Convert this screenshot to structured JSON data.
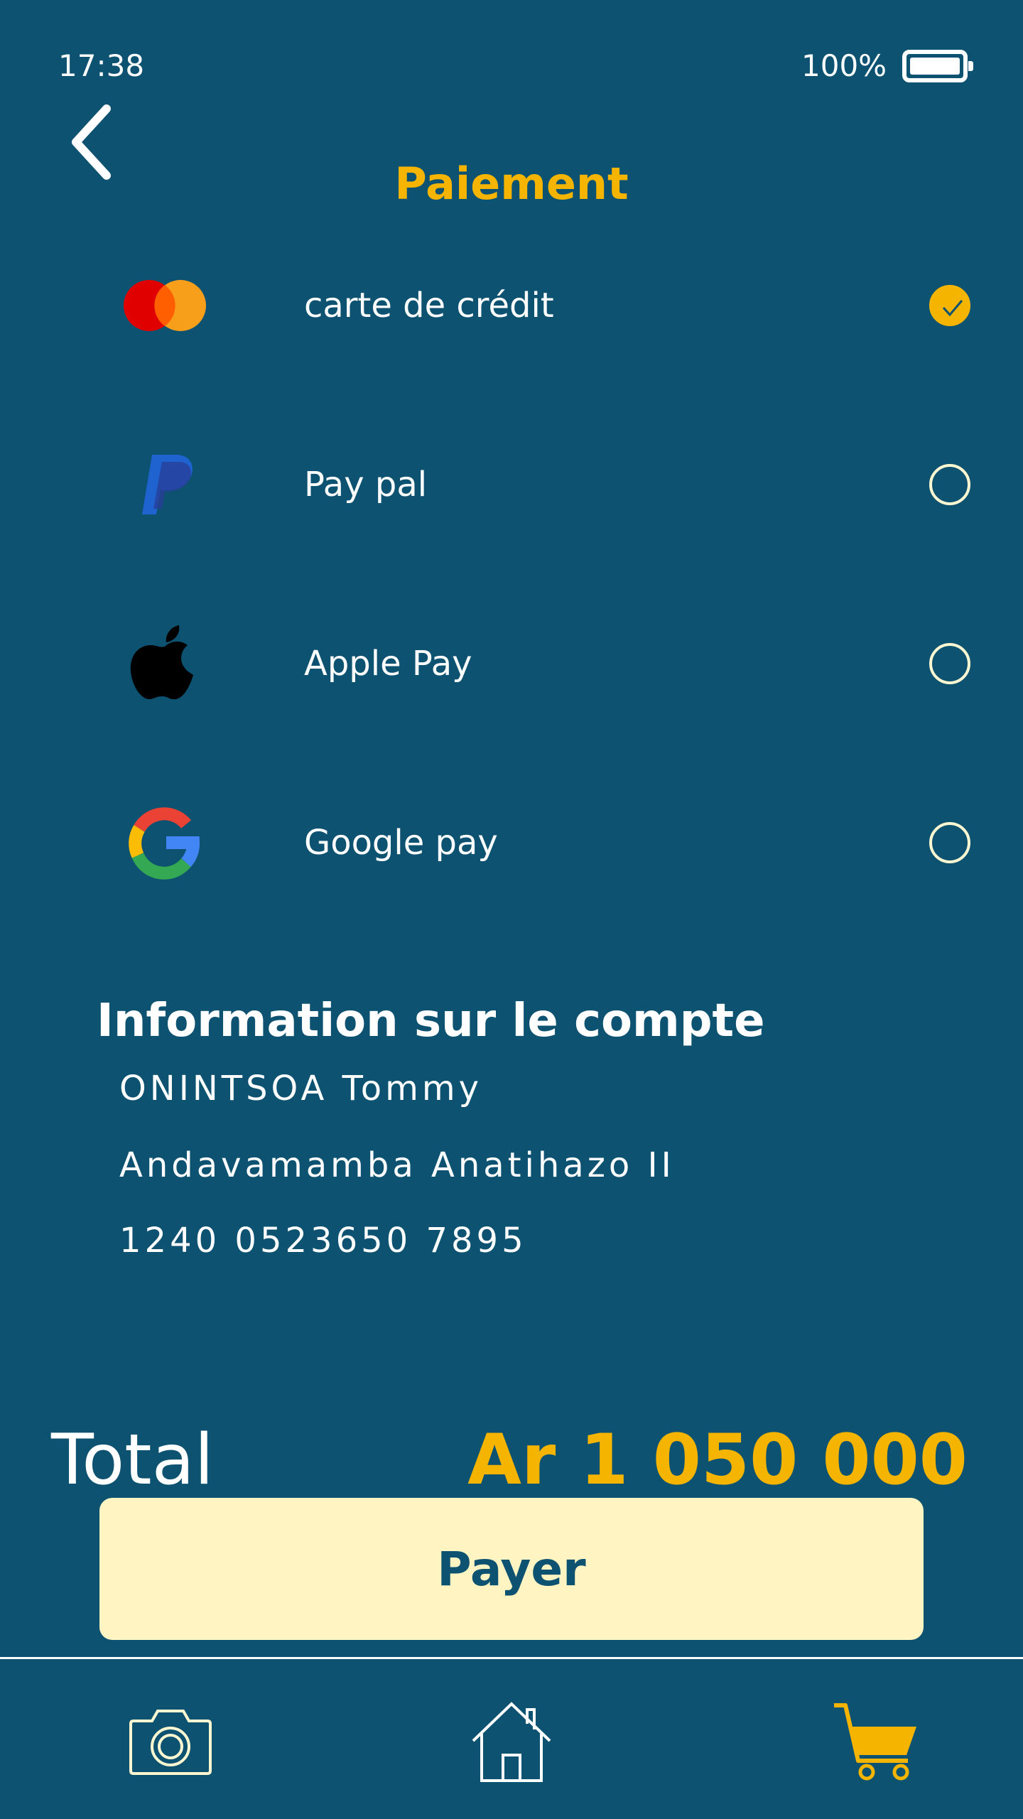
{
  "status_bar": {
    "time": "17:38",
    "battery": "100%"
  },
  "header": {
    "title": "Paiement"
  },
  "payment_methods": [
    {
      "label": "carte de crédit",
      "icon": "mastercard-icon",
      "selected": true
    },
    {
      "label": "Pay pal",
      "icon": "paypal-icon",
      "selected": false
    },
    {
      "label": "Apple Pay",
      "icon": "apple-icon",
      "selected": false
    },
    {
      "label": "Google pay",
      "icon": "google-icon",
      "selected": false
    }
  ],
  "account": {
    "title": "Information sur le compte",
    "name": "ONINTSOA Tommy",
    "address": "Andavamamba Anatihazo II",
    "number": "1240 0523650 7895"
  },
  "total": {
    "label": "Total",
    "value": "Ar 1 050 000"
  },
  "pay_button": {
    "label": "Payer"
  },
  "bottom_nav": [
    {
      "icon": "camera-icon",
      "active": false
    },
    {
      "icon": "home-icon",
      "active": false
    },
    {
      "icon": "cart-icon",
      "active": true
    }
  ],
  "colors": {
    "background": "#0d5271",
    "accent": "#f5b400",
    "button": "#fff4c2",
    "text": "#ffffff"
  }
}
